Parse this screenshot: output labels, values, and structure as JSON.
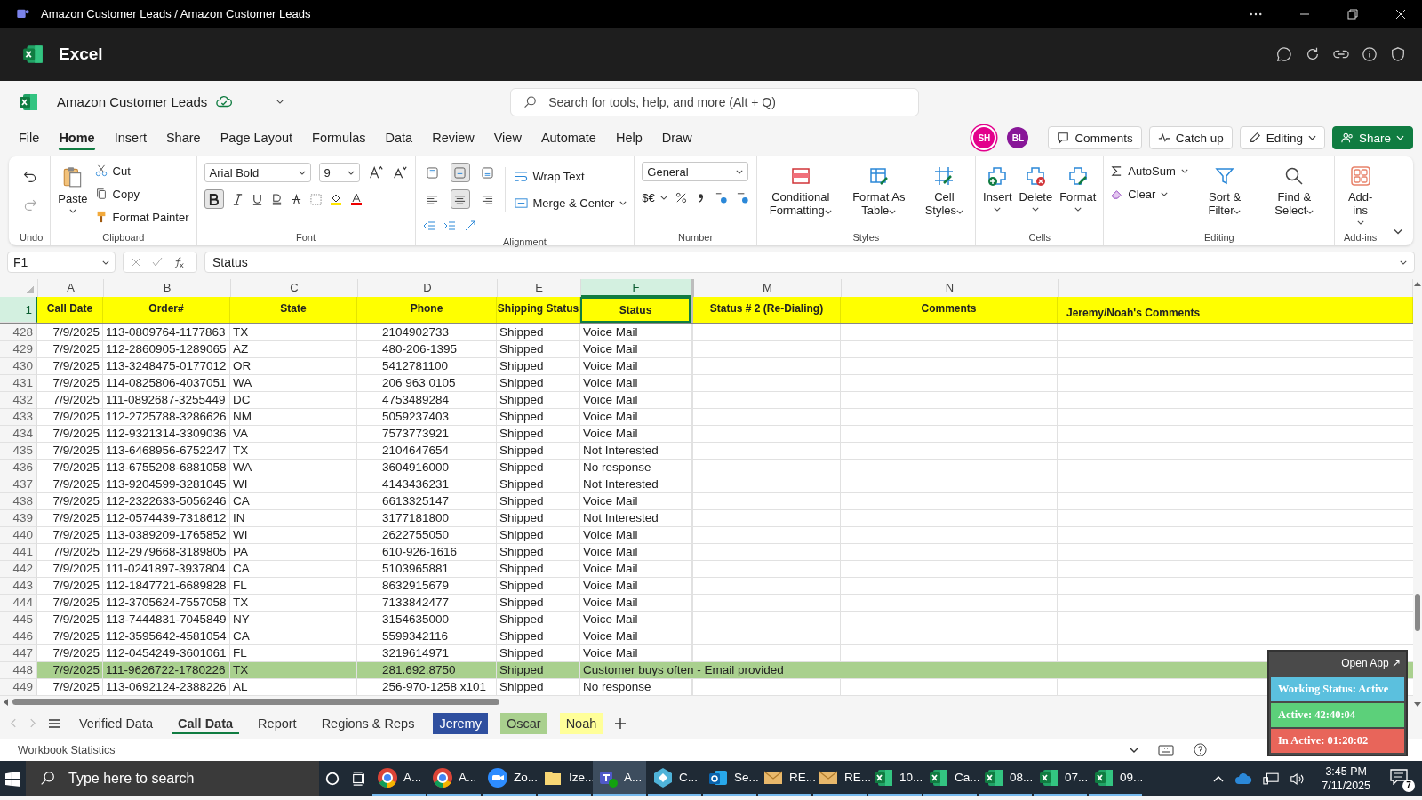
{
  "window": {
    "title": "Amazon Customer Leads / Amazon Customer Leads"
  },
  "app": {
    "name": "Excel"
  },
  "file": {
    "name": "Amazon Customer Leads"
  },
  "search": {
    "placeholder": "Search for tools, help, and more (Alt + Q)"
  },
  "avatars": [
    {
      "initials": "SH",
      "color": "#e3008c"
    },
    {
      "initials": "BL",
      "color": "#881798"
    }
  ],
  "actions": [
    "Comments",
    "Catch up",
    "Editing",
    "Share"
  ],
  "menu": [
    {
      "label": "File",
      "selected": false
    },
    {
      "label": "Home",
      "selected": true
    },
    {
      "label": "Insert",
      "selected": false
    },
    {
      "label": "Share",
      "selected": false
    },
    {
      "label": "Page Layout",
      "selected": false
    },
    {
      "label": "Formulas",
      "selected": false
    },
    {
      "label": "Data",
      "selected": false
    },
    {
      "label": "Review",
      "selected": false
    },
    {
      "label": "View",
      "selected": false
    },
    {
      "label": "Automate",
      "selected": false
    },
    {
      "label": "Help",
      "selected": false
    },
    {
      "label": "Draw",
      "selected": false
    }
  ],
  "ribbon": [
    {
      "kind": "undo",
      "label": "Undo"
    },
    {
      "kind": "clipboard",
      "label": "Clipboard",
      "paste": "Paste",
      "items": [
        "Cut",
        "Copy",
        "Format Painter"
      ]
    },
    {
      "kind": "font",
      "label": "Font",
      "font": "Arial Bold",
      "size": "9",
      "bold": true
    },
    {
      "kind": "alignment",
      "label": "Alignment",
      "wrap": "Wrap Text",
      "merge": "Merge & Center",
      "vertical": [
        false,
        true,
        false
      ],
      "horizontal": [
        false,
        true,
        false
      ]
    },
    {
      "kind": "number",
      "label": "Number",
      "format": "General",
      "currency": "$€"
    },
    {
      "kind": "styles",
      "label": "Styles",
      "items": [
        "Conditional Formatting",
        "Format As Table",
        "Cell Styles"
      ]
    },
    {
      "kind": "cells",
      "label": "Cells",
      "items": [
        "Insert",
        "Delete",
        "Format"
      ]
    },
    {
      "kind": "editing",
      "label": "Editing",
      "items": [
        "AutoSum",
        "Clear"
      ],
      "large": [
        "Sort & Filter",
        "Find & Select"
      ]
    },
    {
      "kind": "addins",
      "label": "Add-ins",
      "items": [
        "Add-ins"
      ]
    }
  ],
  "formula_bar": {
    "name_box": "F1",
    "value": "Status"
  },
  "columns": [
    {
      "letter": "A",
      "title": "Call Date",
      "selected": false
    },
    {
      "letter": "B",
      "title": "Order#",
      "selected": false
    },
    {
      "letter": "C",
      "title": "State",
      "selected": false
    },
    {
      "letter": "D",
      "title": "Phone",
      "selected": false
    },
    {
      "letter": "E",
      "title": "Shipping Status",
      "selected": false
    },
    {
      "letter": "F",
      "title": "Status",
      "selected": true
    },
    {
      "letter": "M",
      "title": "Status # 2 (Re-Dialing)",
      "selected": false
    },
    {
      "letter": "N",
      "title": "Comments",
      "selected": false
    },
    {
      "title": "Jeremy/Noah's Comments",
      "selected": false
    }
  ],
  "header_row": "1",
  "rows": [
    {
      "row": "428",
      "cells": [
        "7/9/2025",
        "113-0809764-1177863",
        "TX",
        "2104902733",
        "Shipped",
        "Voice Mail"
      ],
      "highlighted": false
    },
    {
      "row": "429",
      "cells": [
        "7/9/2025",
        "112-2860905-1289065",
        "AZ",
        "480-206-1395",
        "Shipped",
        "Voice Mail"
      ],
      "highlighted": false
    },
    {
      "row": "430",
      "cells": [
        "7/9/2025",
        "113-3248475-0177012",
        "OR",
        "5412781100",
        "Shipped",
        "Voice Mail"
      ],
      "highlighted": false
    },
    {
      "row": "431",
      "cells": [
        "7/9/2025",
        "114-0825806-4037051",
        "WA",
        "206 963 0105",
        "Shipped",
        "Voice Mail"
      ],
      "highlighted": false
    },
    {
      "row": "432",
      "cells": [
        "7/9/2025",
        "111-0892687-3255449",
        "DC",
        "4753489284",
        "Shipped",
        "Voice Mail"
      ],
      "highlighted": false
    },
    {
      "row": "433",
      "cells": [
        "7/9/2025",
        "112-2725788-3286626",
        "NM",
        "5059237403",
        "Shipped",
        "Voice Mail"
      ],
      "highlighted": false
    },
    {
      "row": "434",
      "cells": [
        "7/9/2025",
        "112-9321314-3309036",
        "VA",
        "7573773921",
        "Shipped",
        "Voice Mail"
      ],
      "highlighted": false
    },
    {
      "row": "435",
      "cells": [
        "7/9/2025",
        "113-6468956-6752247",
        "TX",
        "2104647654",
        "Shipped",
        "Not Interested"
      ],
      "highlighted": false
    },
    {
      "row": "436",
      "cells": [
        "7/9/2025",
        "113-6755208-6881058",
        "WA",
        "3604916000",
        "Shipped",
        "No response"
      ],
      "highlighted": false
    },
    {
      "row": "437",
      "cells": [
        "7/9/2025",
        "113-9204599-3281045",
        "WI",
        "4143436231",
        "Shipped",
        "Not Interested"
      ],
      "highlighted": false
    },
    {
      "row": "438",
      "cells": [
        "7/9/2025",
        "112-2322633-5056246",
        "CA",
        "6613325147",
        "Shipped",
        "Voice Mail"
      ],
      "highlighted": false
    },
    {
      "row": "439",
      "cells": [
        "7/9/2025",
        "112-0574439-7318612",
        "IN",
        "3177181800",
        "Shipped",
        "Not Interested"
      ],
      "highlighted": false
    },
    {
      "row": "440",
      "cells": [
        "7/9/2025",
        "113-0389209-1765852",
        "WI",
        "2622755050",
        "Shipped",
        "Voice Mail"
      ],
      "highlighted": false
    },
    {
      "row": "441",
      "cells": [
        "7/9/2025",
        "112-2979668-3189805",
        "PA",
        "610-926-1616",
        "Shipped",
        "Voice Mail"
      ],
      "highlighted": false
    },
    {
      "row": "442",
      "cells": [
        "7/9/2025",
        "111-0241897-3937804",
        "CA",
        "5103965881",
        "Shipped",
        "Voice Mail"
      ],
      "highlighted": false
    },
    {
      "row": "443",
      "cells": [
        "7/9/2025",
        "112-1847721-6689828",
        "FL",
        "8632915679",
        "Shipped",
        "Voice Mail"
      ],
      "highlighted": false
    },
    {
      "row": "444",
      "cells": [
        "7/9/2025",
        "112-3705624-7557058",
        "TX",
        "7133842477",
        "Shipped",
        "Voice Mail"
      ],
      "highlighted": false
    },
    {
      "row": "445",
      "cells": [
        "7/9/2025",
        "113-7444831-7045849",
        "NY",
        "3154635000",
        "Shipped",
        "Voice Mail"
      ],
      "highlighted": false
    },
    {
      "row": "446",
      "cells": [
        "7/9/2025",
        "112-3595642-4581054",
        "CA",
        "5599342116",
        "Shipped",
        "Voice Mail"
      ],
      "highlighted": false
    },
    {
      "row": "447",
      "cells": [
        "7/9/2025",
        "112-0454249-3601061",
        "FL",
        "3219614971",
        "Shipped",
        "Voice Mail"
      ],
      "highlighted": false
    },
    {
      "row": "448",
      "cells": [
        "7/9/2025",
        "111-9626722-1780226",
        "TX",
        "281.692.8750",
        "Shipped",
        "Customer buys often - Email provided"
      ],
      "highlighted": true
    },
    {
      "row": "449",
      "cells": [
        "7/9/2025",
        "113-0692124-2388226",
        "AL",
        "256-970-1258 x101",
        "Shipped",
        "No response"
      ],
      "highlighted": false
    }
  ],
  "sheets": [
    {
      "label": "Verified Data",
      "selected": false
    },
    {
      "label": "Call Data",
      "selected": true
    },
    {
      "label": "Report",
      "selected": false
    },
    {
      "label": "Regions & Reps",
      "selected": false
    },
    {
      "label": "Jeremy",
      "selected": false,
      "color": "#2f4f9f"
    },
    {
      "label": "Oscar",
      "selected": false,
      "color": "#a9d08e"
    },
    {
      "label": "Noah",
      "selected": false,
      "color": "#ffff99"
    }
  ],
  "status_bar": {
    "text": "Workbook Statistics"
  },
  "tracker": {
    "open": "Open App ↗",
    "items": [
      {
        "text": "Working Status: Active",
        "color": "#5bc0de"
      },
      {
        "text": "Active: 42:40:04",
        "color": "#5cd07a"
      },
      {
        "text": "In Active: 01:20:02",
        "color": "#e8655a"
      }
    ]
  },
  "taskbar": {
    "search": {
      "placeholder": "Type here to search"
    },
    "apps": [
      {
        "kind": "chrome",
        "label": "A...",
        "selected": false
      },
      {
        "kind": "chrome",
        "label": "A...",
        "selected": false
      },
      {
        "kind": "zoom",
        "label": "Zo...",
        "selected": false
      },
      {
        "kind": "folder",
        "label": "Ize...",
        "selected": false
      },
      {
        "kind": "teams",
        "label": "A...",
        "selected": true
      },
      {
        "kind": "hex",
        "label": "C...",
        "selected": false
      },
      {
        "kind": "outlook",
        "label": "Se...",
        "selected": false
      },
      {
        "kind": "mail",
        "label": "RE...",
        "selected": false
      },
      {
        "kind": "mail",
        "label": "RE...",
        "selected": false
      },
      {
        "kind": "excel",
        "label": "10...",
        "selected": false
      },
      {
        "kind": "excel",
        "label": "Ca...",
        "selected": false
      },
      {
        "kind": "excel",
        "label": "08...",
        "selected": false
      },
      {
        "kind": "excel",
        "label": "07...",
        "selected": false
      },
      {
        "kind": "excel",
        "label": "09...",
        "selected": false
      }
    ],
    "time": "3:45 PM",
    "date": "7/11/2025",
    "notifications": "7"
  }
}
